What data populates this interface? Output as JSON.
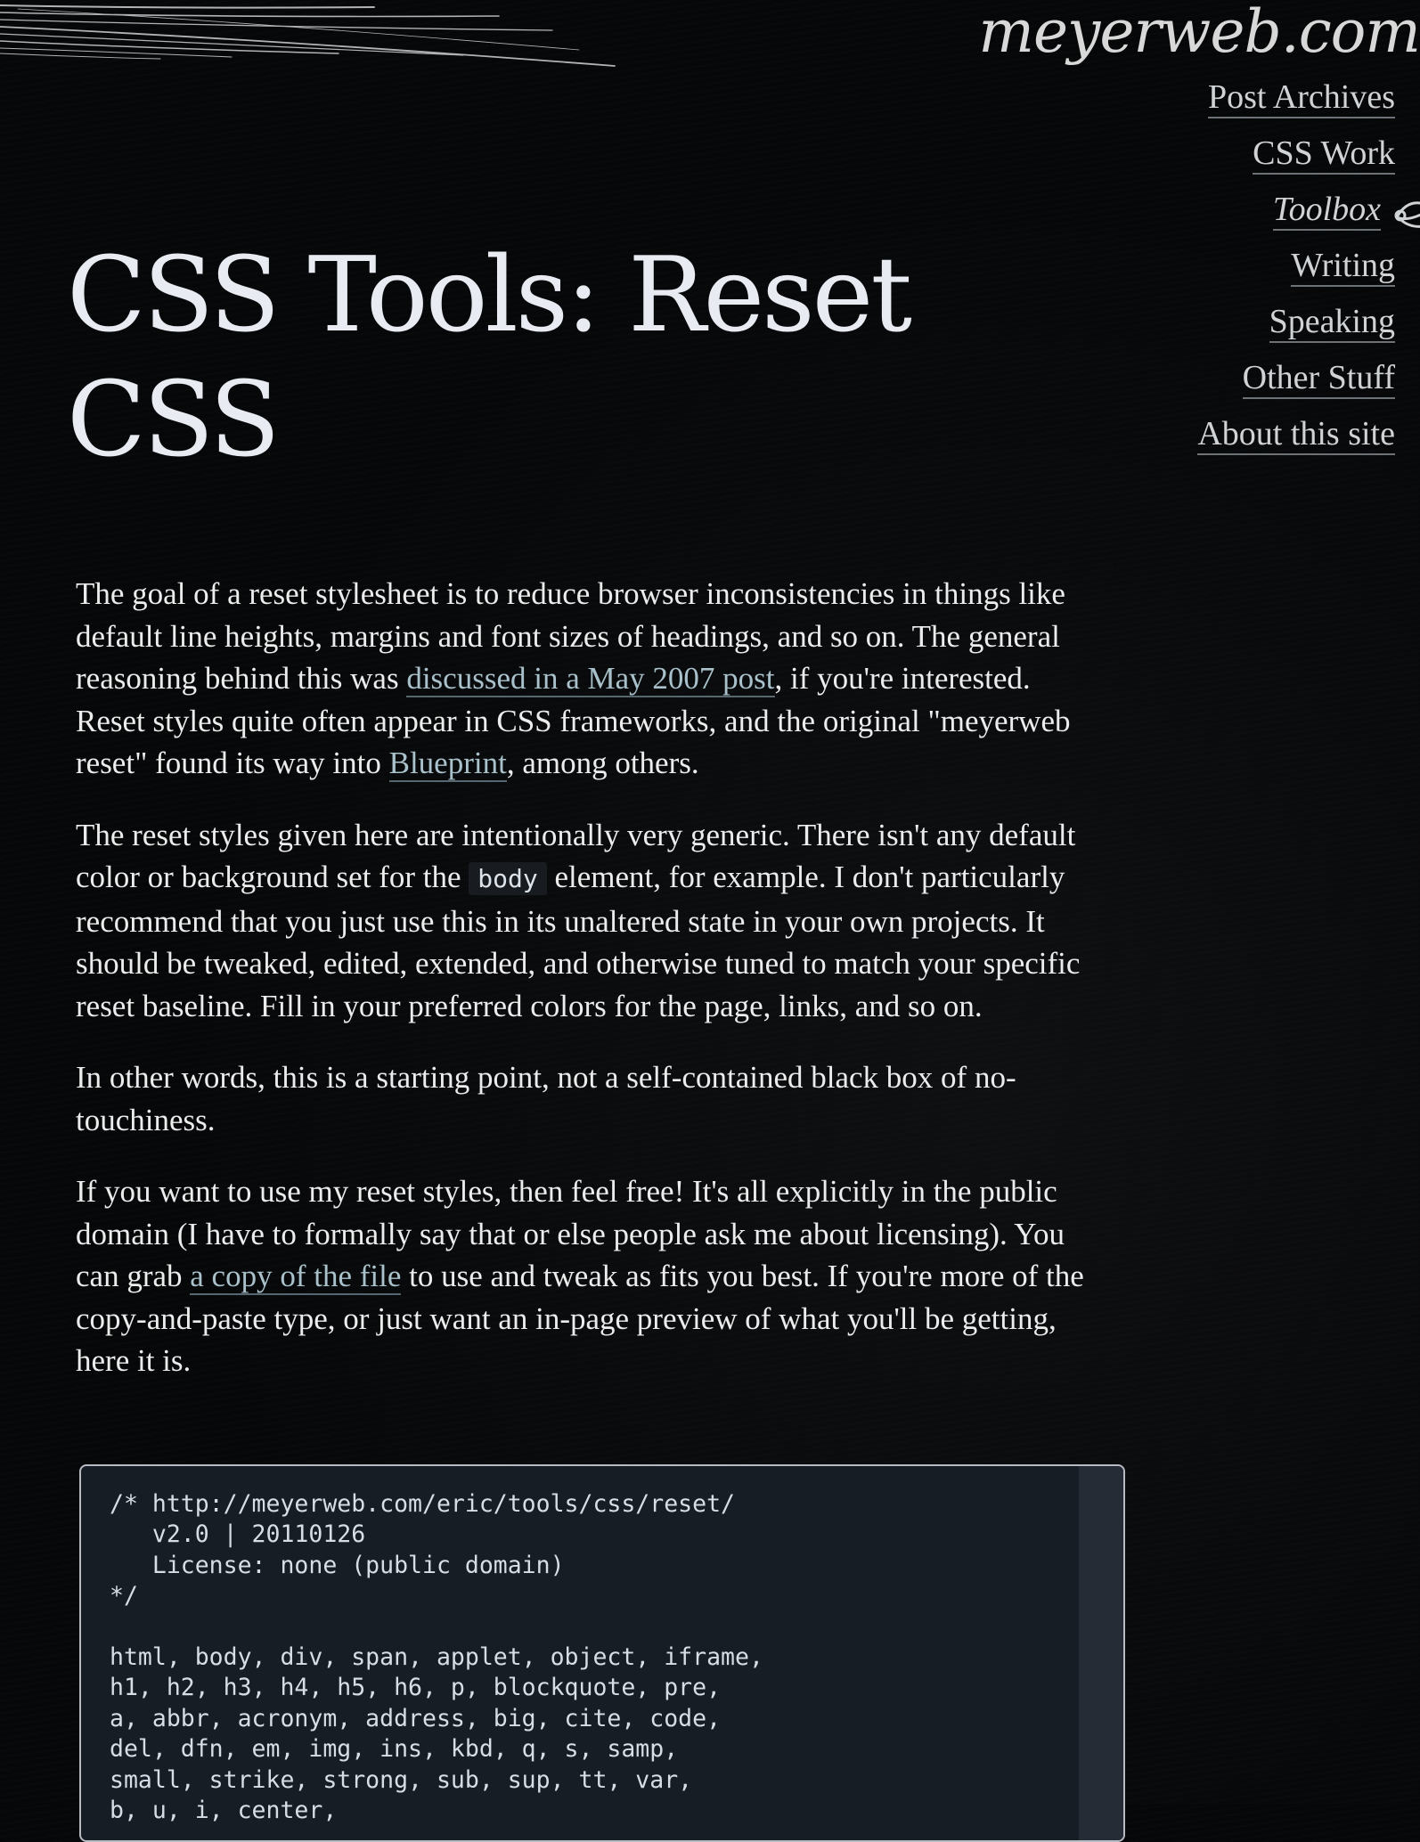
{
  "site": {
    "name": "meyerweb.com"
  },
  "nav": {
    "items": [
      {
        "label": "Post Archives",
        "current": false
      },
      {
        "label": "CSS Work",
        "current": false
      },
      {
        "label": "Toolbox",
        "current": true
      },
      {
        "label": "Writing",
        "current": false
      },
      {
        "label": "Speaking",
        "current": false
      },
      {
        "label": "Other Stuff",
        "current": false
      },
      {
        "label": "About this site",
        "current": false
      }
    ]
  },
  "page": {
    "title": "CSS Tools: Reset CSS"
  },
  "content": {
    "p1": {
      "before": "The goal of a reset stylesheet is to reduce browser inconsistencies in things like default line heights, margins and font sizes of headings, and so on. The general reasoning behind this was ",
      "link1": "discussed in a May 2007 post",
      "middle": ", if you're interested. Reset styles quite often appear in CSS frameworks, and the original \"meyerweb reset\" found its way into ",
      "link2": "Blueprint",
      "after": ", among others."
    },
    "p2": {
      "before": "The reset styles given here are intentionally very generic. There isn't any default color or background set for the ",
      "code": "body",
      "after": " element, for example. I don't particularly recommend that you just use this in its unaltered state in your own projects. It should be tweaked, edited, extended, and otherwise tuned to match your specific reset baseline. Fill in your preferred colors for the page, links, and so on."
    },
    "p3": "In other words, this is a starting point, not a self-contained black box of no-touchiness.",
    "p4": {
      "before": "If you want to use my reset styles, then feel free! It's all explicitly in the public domain (I have to formally say that or else people ask me about licensing). You can grab ",
      "link": "a copy of the file",
      "after": " to use and tweak as fits you best. If you're more of the copy-and-paste type, or just want an in-page preview of what you'll be getting, here it is."
    },
    "code_block": "/* http://meyerweb.com/eric/tools/css/reset/\n   v2.0 | 20110126\n   License: none (public domain)\n*/\n\nhtml, body, div, span, applet, object, iframe,\nh1, h2, h3, h4, h5, h6, p, blockquote, pre,\na, abbr, acronym, address, big, cite, code,\ndel, dfn, em, img, ins, kbd, q, s, samp,\nsmall, strike, strong, sub, sup, tt, var,\nb, u, i, center,"
  },
  "colors": {
    "background": "#060708",
    "link": "#a9c1cb",
    "code_background": "#171d24",
    "title": "#e8ebf2"
  }
}
